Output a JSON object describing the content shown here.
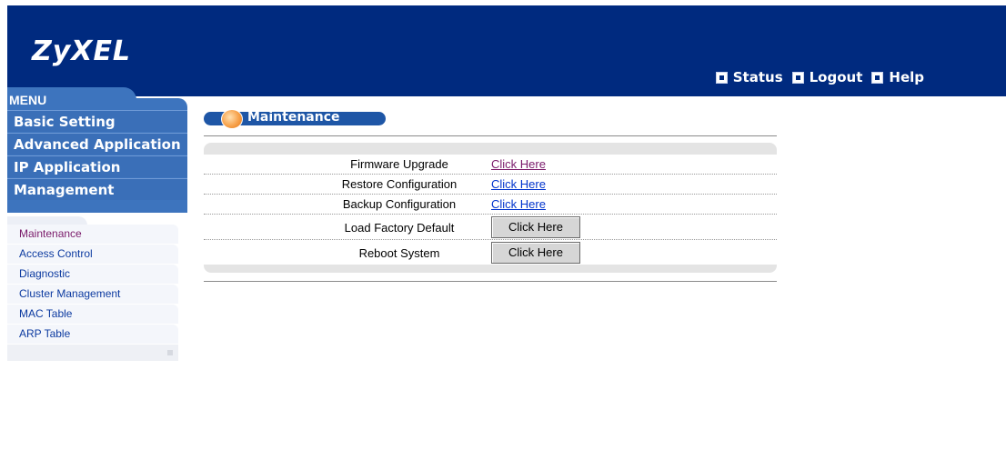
{
  "header": {
    "logo": "ZyXEL",
    "links": [
      {
        "label": "Status",
        "icon": "status-icon"
      },
      {
        "label": "Logout",
        "icon": "logout-icon"
      },
      {
        "label": "Help",
        "icon": "help-icon"
      }
    ]
  },
  "menu": {
    "title": "MENU",
    "items": [
      "Basic Setting",
      "Advanced Application",
      "IP Application",
      "Management"
    ],
    "submenu": [
      "Maintenance",
      "Access Control",
      "Diagnostic",
      "Cluster Management",
      "MAC Table",
      "ARP Table"
    ]
  },
  "page": {
    "title": "Maintenance",
    "rows": [
      {
        "label": "Firmware Upgrade",
        "action": "Click Here",
        "type": "link"
      },
      {
        "label": "Restore Configuration",
        "action": "Click Here",
        "type": "link"
      },
      {
        "label": "Backup Configuration",
        "action": "Click Here",
        "type": "link"
      },
      {
        "label": "Load Factory Default",
        "action": "Click Here",
        "type": "button"
      },
      {
        "label": "Reboot System",
        "action": "Click Here",
        "type": "button"
      }
    ]
  },
  "colors": {
    "header_bg": "#002a7f",
    "menu_bg": "#3d74be",
    "link": "#0033cc"
  }
}
